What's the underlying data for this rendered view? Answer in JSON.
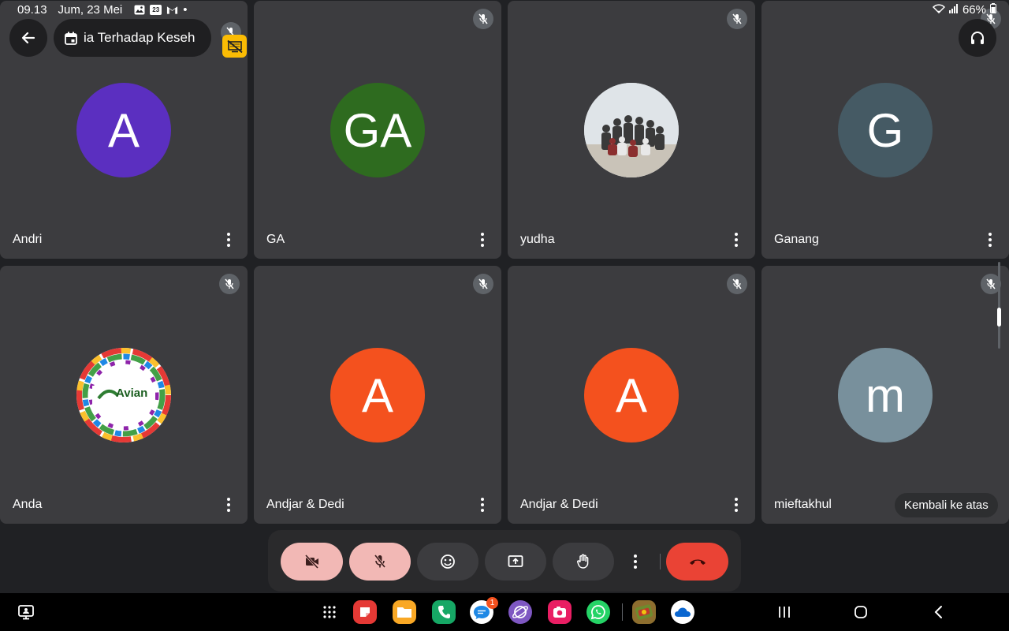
{
  "status_bar": {
    "time": "09.13",
    "date": "Jum, 23 Mei",
    "dot": "•",
    "battery": "66%",
    "calendar_day": "23"
  },
  "header": {
    "meeting_title": "ia Terhadap Keseh"
  },
  "participants": [
    {
      "name": "Andri",
      "initials": "A",
      "color": "#5b2fc0",
      "avatar_type": "letter"
    },
    {
      "name": "GA",
      "initials": "GA",
      "color": "#2e6b1f",
      "avatar_type": "letter"
    },
    {
      "name": "yudha",
      "initials": "",
      "color": "#9aa0a6",
      "avatar_type": "photo"
    },
    {
      "name": "Ganang",
      "initials": "G",
      "color": "#455a64",
      "avatar_type": "letter"
    },
    {
      "name": "Anda",
      "initials": "",
      "color": "#ffffff",
      "avatar_type": "logo",
      "logo_text": "Avian"
    },
    {
      "name": "Andjar & Dedi",
      "initials": "A",
      "color": "#f4511e",
      "avatar_type": "letter"
    },
    {
      "name": "Andjar & Dedi",
      "initials": "A",
      "color": "#f4511e",
      "avatar_type": "letter"
    },
    {
      "name": "mieftakhul",
      "initials": "m",
      "color": "#78909c",
      "avatar_type": "letter"
    }
  ],
  "back_to_top": "Kembali ke atas",
  "controls": [
    {
      "id": "camera",
      "icon": "camera-off-icon",
      "state": "off"
    },
    {
      "id": "mic",
      "icon": "mic-off-icon",
      "state": "off"
    },
    {
      "id": "reactions",
      "icon": "emoji-icon"
    },
    {
      "id": "present",
      "icon": "present-screen-icon"
    },
    {
      "id": "raise-hand",
      "icon": "hand-icon"
    },
    {
      "id": "more",
      "icon": "more-vert-icon"
    },
    {
      "id": "leave",
      "icon": "end-call-icon"
    }
  ],
  "taskbar": {
    "messages_badge": "1",
    "apps": [
      "apps-grid-icon",
      "sticker-app-icon",
      "files-icon",
      "phone-icon",
      "messages-icon",
      "browser-icon",
      "camera-app-icon",
      "whatsapp-icon",
      "game-icon",
      "onedrive-icon"
    ]
  },
  "colors": {
    "tile_bg": "#3c3c3f",
    "control_off": "#f2b8b5",
    "end_call": "#ea4335",
    "badge_yellow": "#fbbc04"
  }
}
